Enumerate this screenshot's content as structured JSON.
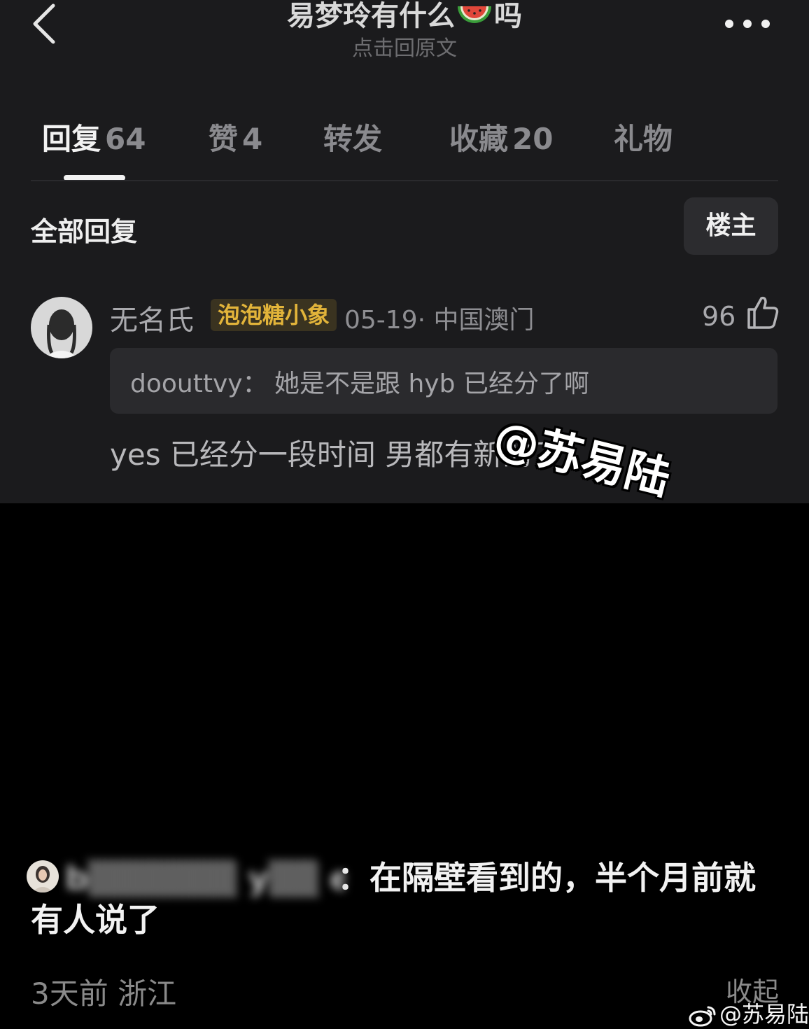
{
  "header": {
    "title": "易梦玲有什么",
    "title_suffix": "吗",
    "title_emoji": "watermelon-icon",
    "subtitle": "点击回原文"
  },
  "tabs": [
    {
      "label": "回复",
      "count": "64",
      "active": true
    },
    {
      "label": "赞",
      "count": "4",
      "active": false
    },
    {
      "label": "转发",
      "count": "",
      "active": false
    },
    {
      "label": "收藏",
      "count": "20",
      "active": false
    },
    {
      "label": "礼物",
      "count": "",
      "active": false
    }
  ],
  "section": {
    "title": "全部回复",
    "filter_label": "楼主"
  },
  "reply": {
    "username": "无名氏",
    "badge": "泡泡糖小象",
    "meta": "05-19· 中国澳门",
    "likes": "96",
    "quote_author": "doouttvy：",
    "quote_text": "她是不是跟 hyb 已经分了啊",
    "text": "yes 已经分一段时间 男都有新的了"
  },
  "overlay_watermark": "@苏易陆",
  "bottom_comment": {
    "username": "b▒▒▒▒▒▒ y▒▒ e",
    "text": "：在隔壁看到的，半个月前就有人说了",
    "time": "3天前",
    "location": "浙江",
    "collapse_label": "收起"
  },
  "footer_watermark": "@苏易陆",
  "colors": {
    "panel_bg": "#1b1b1d",
    "badge_text": "#e2b43a",
    "page_bg": "#000000"
  }
}
